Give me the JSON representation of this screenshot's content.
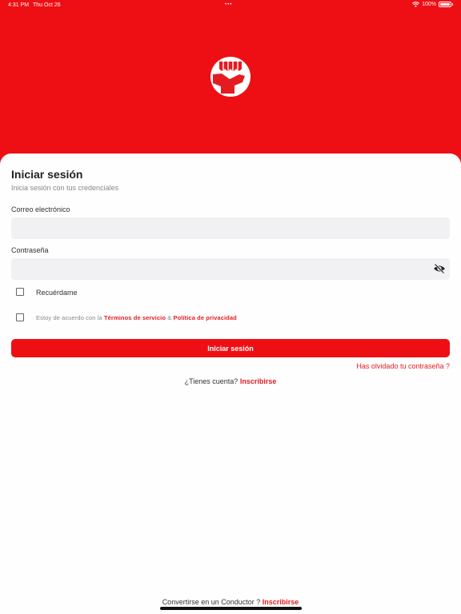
{
  "status_bar": {
    "time": "4:31 PM",
    "date": "Thu Oct 26",
    "dots": "•••",
    "battery": "100%"
  },
  "brand": {
    "logo_icon": "store-awning-icon",
    "primary_color": "#ee0f14",
    "link_color": "#e41b20"
  },
  "login": {
    "title": "Iniciar sesión",
    "subtitle": "Inicia sesión con tus credenciales",
    "email_label": "Correo electrónico",
    "email_value": "",
    "password_label": "Contraseña",
    "password_value": "",
    "password_toggle_icon": "eye-off-icon",
    "remember_label": "Recuérdame",
    "remember_checked": false,
    "terms_prefix": "Estoy de acuerdo con la",
    "terms_link": "Términos de servicio",
    "terms_and": "&",
    "privacy_link": "Política de privacidad",
    "terms_checked": false,
    "submit_label": "Iniciar sesión",
    "forgot_label": "Has olvidado tu contraseña ?",
    "signup_prompt": "¿Tienes cuenta?",
    "signup_link": "Inscribirse"
  },
  "driver": {
    "prompt": "Convertirse en un Conductor ?",
    "link": "Inscribirse"
  }
}
